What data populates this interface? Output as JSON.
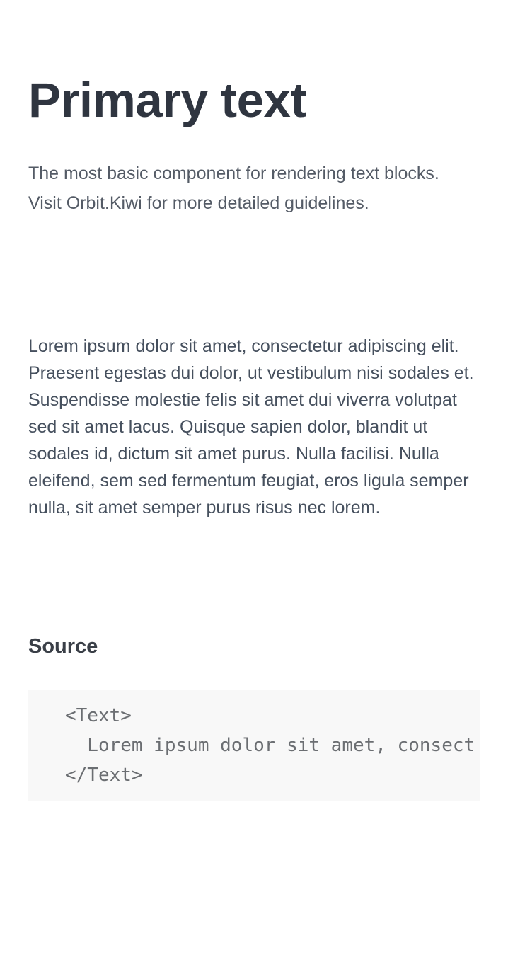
{
  "page": {
    "title": "Primary text",
    "description": "The most basic component for rendering text blocks. Visit Orbit.Kiwi for more detailed guidelines."
  },
  "example": {
    "text": "Lorem ipsum dolor sit amet, consectetur adipiscing elit. Praesent egestas dui dolor, ut vestibulum nisi sodales et. Suspendisse molestie felis sit amet dui viverra volutpat sed sit amet lacus. Quisque sapien dolor, blandit ut sodales id, dictum sit amet purus. Nulla facilisi. Nulla eleifend, sem sed fermentum feugiat, eros ligula semper nulla, sit amet semper purus risus nec lorem."
  },
  "source": {
    "heading": "Source",
    "code_lines": [
      "<Text>",
      "  Lorem ipsum dolor sit amet, consect",
      "</Text>"
    ]
  },
  "colors": {
    "title": "#2f3540",
    "description": "#545b66",
    "body": "#46505e",
    "code_background": "#f8f8f8",
    "code_text": "#6b6e72"
  }
}
